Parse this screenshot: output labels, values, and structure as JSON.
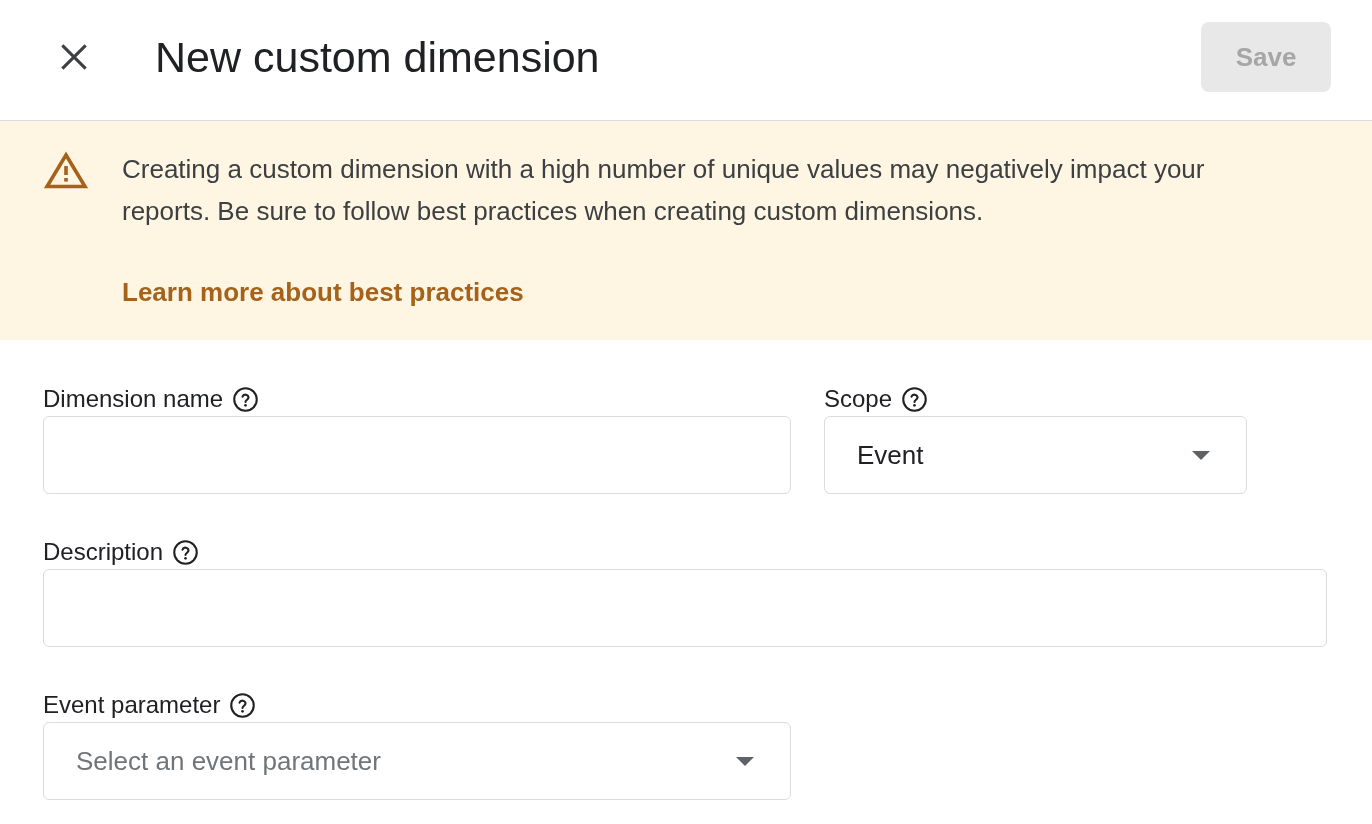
{
  "header": {
    "title": "New custom dimension",
    "save_button": {
      "label": "Save",
      "disabled": true
    }
  },
  "warning": {
    "message": "Creating a custom dimension with a high number of unique values may negatively impact your reports. Be sure to follow best practices when creating custom dimensions.",
    "link": "Learn more about best practices"
  },
  "form": {
    "rows": [
      [
        {
          "kind": "text",
          "label": "Dimension name"
        },
        {
          "kind": "select",
          "label": "Scope",
          "value": "Event"
        }
      ],
      [
        {
          "kind": "text",
          "label": "Description"
        }
      ],
      [
        {
          "kind": "select",
          "label": "Event parameter",
          "placeholder": "Select an event parameter"
        }
      ]
    ]
  }
}
